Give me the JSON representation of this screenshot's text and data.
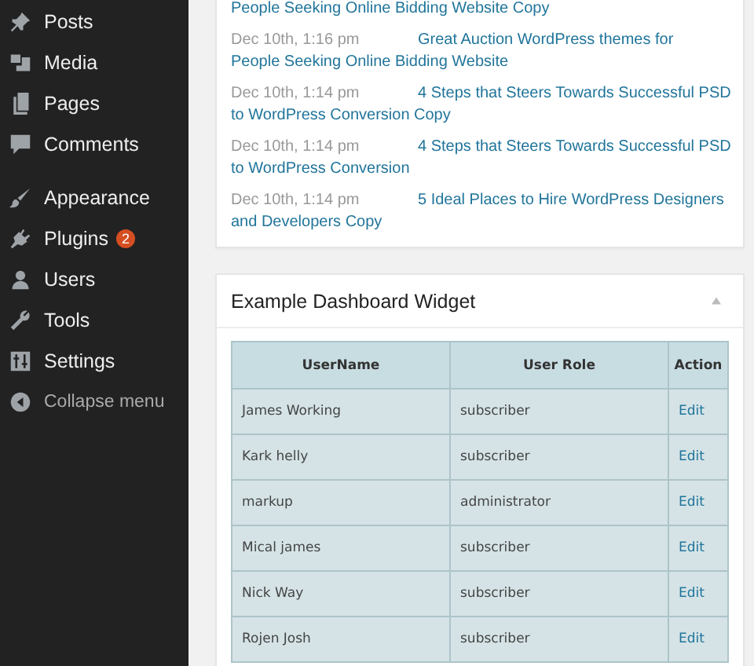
{
  "sidebar": {
    "groups": [
      [
        {
          "label": "Posts"
        },
        {
          "label": "Media"
        },
        {
          "label": "Pages"
        },
        {
          "label": "Comments"
        }
      ],
      [
        {
          "label": "Appearance"
        },
        {
          "label": "Plugins",
          "badge": "2"
        },
        {
          "label": "Users"
        },
        {
          "label": "Tools"
        },
        {
          "label": "Settings"
        }
      ]
    ],
    "collapse": "Collapse menu"
  },
  "activity": [
    {
      "title_lines": [
        "People Seeking Online Bidding Website Copy"
      ]
    },
    {
      "date": "Dec 10th, 1:16 pm",
      "title_lines": [
        "Great Auction WordPress themes for",
        "People Seeking Online Bidding Website"
      ]
    },
    {
      "date": "Dec 10th, 1:14 pm",
      "title_lines": [
        "4 Steps that Steers Towards Successful PSD",
        "to WordPress Conversion Copy"
      ]
    },
    {
      "date": "Dec 10th, 1:14 pm",
      "title_lines": [
        "4 Steps that Steers Towards Successful PSD",
        "to WordPress Conversion"
      ]
    },
    {
      "date": "Dec 10th, 1:14 pm",
      "title_lines": [
        "5 Ideal Places to Hire WordPress Designers",
        "and Developers Copy"
      ]
    }
  ],
  "widget": {
    "title": "Example Dashboard Widget",
    "expanded": true,
    "table": {
      "columns": [
        "UserName",
        "User Role",
        "Action"
      ],
      "rows": [
        {
          "name": "James Working",
          "role": "subscriber",
          "action": "Edit"
        },
        {
          "name": "Kark helly",
          "role": "subscriber",
          "action": "Edit"
        },
        {
          "name": "markup",
          "role": "administrator",
          "action": "Edit"
        },
        {
          "name": "Mical james",
          "role": "subscriber",
          "action": "Edit"
        },
        {
          "name": "Nick Way",
          "role": "subscriber",
          "action": "Edit"
        },
        {
          "name": "Rojen Josh",
          "role": "subscriber",
          "action": "Edit"
        }
      ]
    }
  }
}
